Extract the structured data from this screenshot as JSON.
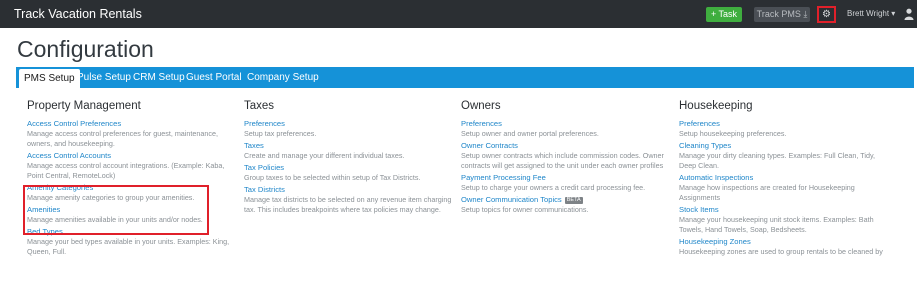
{
  "app": {
    "title": "Track Vacation Rentals"
  },
  "topbar": {
    "task_label": "+ Task",
    "pms_label": "Track PMS",
    "pms_icon": "download-icon",
    "gear_icon": "gear-icon",
    "user_name": "Brett Wright ▾",
    "user_icon": "user-icon",
    "highlight_color": "#e0202a"
  },
  "page": {
    "title": "Configuration"
  },
  "tabs": [
    {
      "label": "PMS Setup",
      "active": true
    },
    {
      "label": "Pulse Setup"
    },
    {
      "label": "CRM Setup"
    },
    {
      "label": "Guest Portal"
    },
    {
      "label": "Company Setup"
    }
  ],
  "columns": [
    {
      "title": "Property Management",
      "items": [
        {
          "link": "Access Control Preferences",
          "desc": "Manage access control preferences for guest, maintenance, owners, and housekeeping."
        },
        {
          "link": "Access Control Accounts",
          "desc": "Manage access control account integrations. (Example: Kaba, Point Central, RemoteLock)"
        },
        {
          "link": "Amenity Categories",
          "desc": "Manage amenity categories to group your amenities."
        },
        {
          "link": "Amenities",
          "desc": "Manage amenities available in your units and/or nodes."
        },
        {
          "link": "Bed Types",
          "desc": "Manage your bed types available in your units. Examples: King, Queen, Full."
        }
      ]
    },
    {
      "title": "Taxes",
      "items": [
        {
          "link": "Preferences",
          "desc": "Setup tax preferences."
        },
        {
          "link": "Taxes",
          "desc": "Create and manage your different individual taxes."
        },
        {
          "link": "Tax Policies",
          "desc": "Group taxes to be selected within setup of Tax Districts."
        },
        {
          "link": "Tax Districts",
          "desc": "Manage tax districts to be selected on any revenue item charging tax. This includes breakpoints where tax policies may change."
        }
      ]
    },
    {
      "title": "Owners",
      "items": [
        {
          "link": "Preferences",
          "desc": "Setup owner and owner portal preferences."
        },
        {
          "link": "Owner Contracts",
          "desc": "Setup owner contracts which include commission codes. Owner contracts will get assigned to the unit under each owner profiles"
        },
        {
          "link": "Payment Processing Fee",
          "desc": "Setup to charge your owners a credit card processing fee."
        },
        {
          "link": "Owner Communication Topics",
          "badge": "BETA",
          "desc": "Setup topics for owner communications."
        }
      ]
    },
    {
      "title": "Housekeeping",
      "items": [
        {
          "link": "Preferences",
          "desc": "Setup housekeeping preferences."
        },
        {
          "link": "Cleaning Types",
          "desc": "Manage your dirty cleaning types. Examples: Full Clean, Tidy, Deep Clean."
        },
        {
          "link": "Automatic Inspections",
          "desc": "Manage how inspections are created for Housekeeping Assignments"
        },
        {
          "link": "Stock Items",
          "desc": "Manage your housekeeping unit stock items. Examples: Bath Towels, Hand Towels, Soap, Bedsheets."
        },
        {
          "link": "Housekeeping Zones",
          "desc": "Housekeeping zones are used to group rentals to be cleaned by"
        }
      ]
    }
  ]
}
